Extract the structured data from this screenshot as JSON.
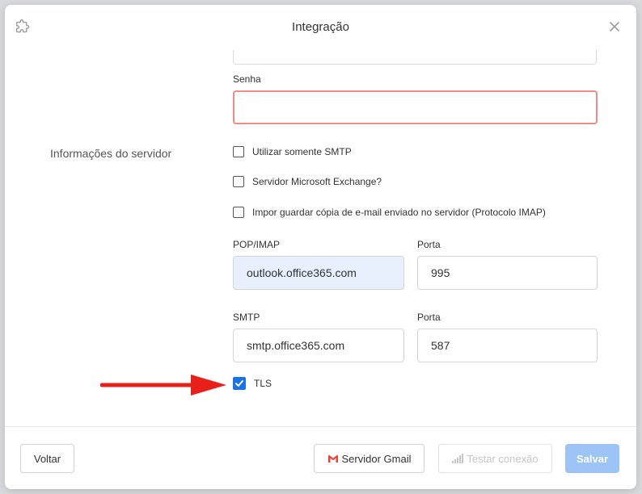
{
  "dialog": {
    "title": "Integração"
  },
  "form": {
    "password": {
      "label": "Senha",
      "value": ""
    },
    "server_section_label": "Informações do servidor",
    "checkboxes": [
      {
        "label": "Utilizar somente SMTP",
        "checked": false
      },
      {
        "label": "Servidor Microsoft Exchange?",
        "checked": false
      },
      {
        "label": "Impor guardar cópia de e-mail enviado no servidor (Protocolo IMAP)",
        "checked": false
      }
    ],
    "pop_imap": {
      "label": "POP/IMAP",
      "value": "outlook.office365.com"
    },
    "pop_port": {
      "label": "Porta",
      "value": "995"
    },
    "smtp": {
      "label": "SMTP",
      "value": "smtp.office365.com"
    },
    "smtp_port": {
      "label": "Porta",
      "value": "587"
    },
    "tls": {
      "label": "TLS",
      "checked": true
    }
  },
  "annotation": {
    "arrow_color": "#e8201a"
  },
  "footer": {
    "back_label": "Voltar",
    "gmail_label": "Servidor Gmail",
    "test_label": "Testar conexão",
    "save_label": "Salvar"
  },
  "colors": {
    "accent": "#1a73e8",
    "error_border": "#f08b85",
    "autofill_bg": "#e8f0fe",
    "save_disabled": "#9cc4f7",
    "gmail_red": "#ea4335"
  }
}
